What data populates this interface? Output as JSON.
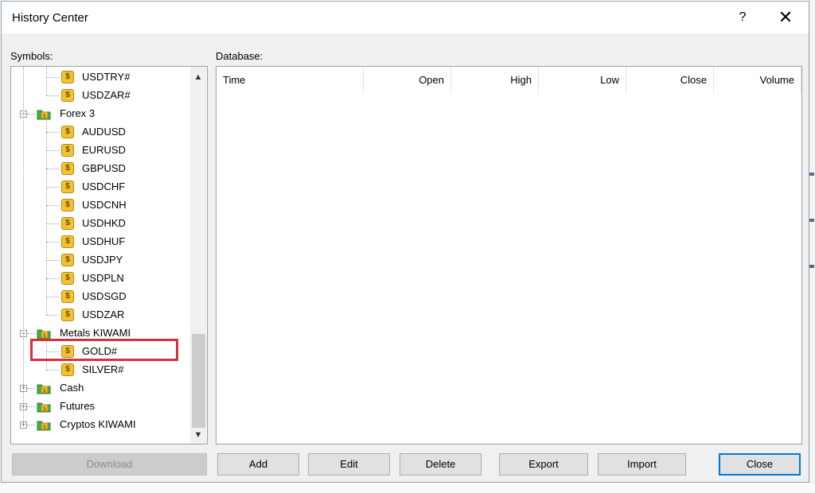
{
  "window": {
    "title": "History Center",
    "help_glyph": "?",
    "close_glyph": "✕"
  },
  "labels": {
    "symbols": "Symbols:",
    "database": "Database:"
  },
  "tree": {
    "items": [
      {
        "label": "USDTRY#",
        "kind": "symbol"
      },
      {
        "label": "USDZAR#",
        "kind": "symbol"
      },
      {
        "label": "Forex 3",
        "kind": "group",
        "expander": "−"
      },
      {
        "label": "AUDUSD",
        "kind": "symbol"
      },
      {
        "label": "EURUSD",
        "kind": "symbol"
      },
      {
        "label": "GBPUSD",
        "kind": "symbol"
      },
      {
        "label": "USDCHF",
        "kind": "symbol"
      },
      {
        "label": "USDCNH",
        "kind": "symbol"
      },
      {
        "label": "USDHKD",
        "kind": "symbol"
      },
      {
        "label": "USDHUF",
        "kind": "symbol"
      },
      {
        "label": "USDJPY",
        "kind": "symbol"
      },
      {
        "label": "USDPLN",
        "kind": "symbol"
      },
      {
        "label": "USDSGD",
        "kind": "symbol"
      },
      {
        "label": "USDZAR",
        "kind": "symbol"
      },
      {
        "label": "Metals KIWAMI",
        "kind": "group",
        "expander": "−"
      },
      {
        "label": "GOLD#",
        "kind": "symbol",
        "highlighted": true
      },
      {
        "label": "SILVER#",
        "kind": "symbol"
      },
      {
        "label": "Cash",
        "kind": "group",
        "expander": "+"
      },
      {
        "label": "Futures",
        "kind": "group",
        "expander": "+"
      },
      {
        "label": "Cryptos KIWAMI",
        "kind": "group",
        "expander": "+"
      }
    ],
    "symbol_icon": "dollar-coin-icon",
    "group_icon": "folder-green-icon",
    "highlight_color": "#d3323f"
  },
  "database": {
    "columns": [
      "Time",
      "Open",
      "High",
      "Low",
      "Close",
      "Volume"
    ]
  },
  "buttons": {
    "download": "Download",
    "add": "Add",
    "edit": "Edit",
    "delete": "Delete",
    "export": "Export",
    "import": "Import",
    "close": "Close"
  },
  "colors": {
    "accent": "#0078d7",
    "dialog_bg": "#f0f0f0"
  }
}
